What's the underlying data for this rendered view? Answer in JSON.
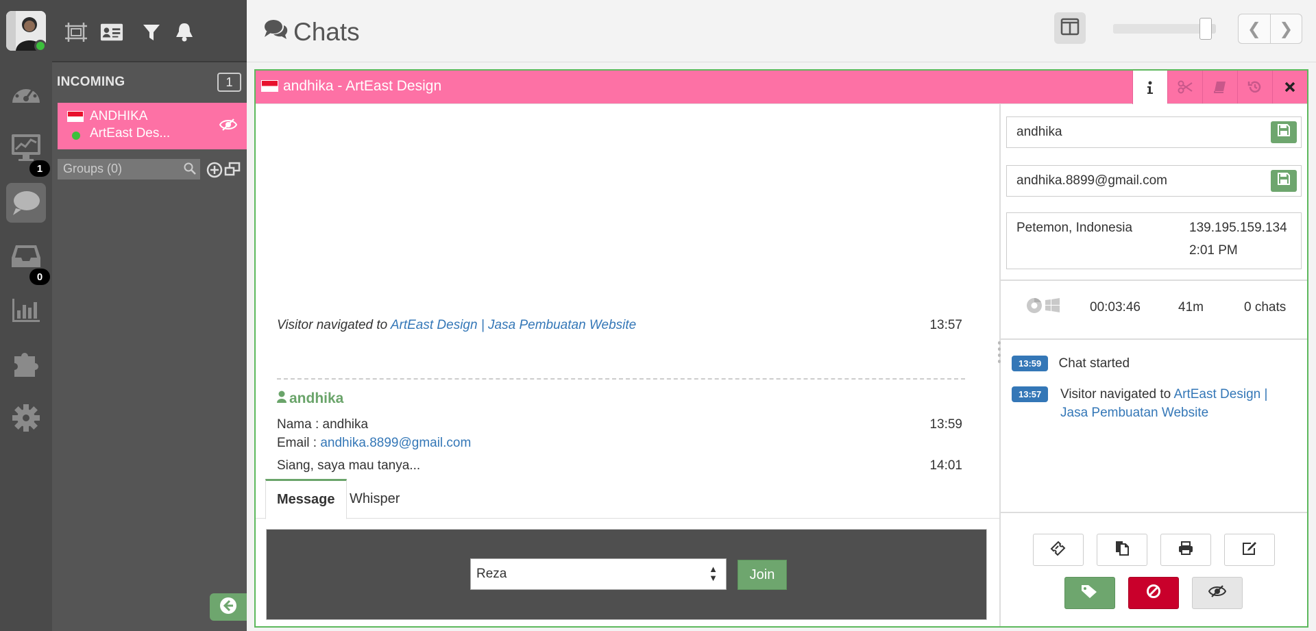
{
  "rail": {
    "badges": {
      "monitor": "1",
      "inbox": "0"
    }
  },
  "sidebar": {
    "incoming_title": "INCOMING",
    "incoming_count": "1",
    "chat": {
      "name": "ANDHIKA",
      "site": "ArtEast Des..."
    },
    "groups_placeholder": "Groups (0)"
  },
  "header": {
    "title": "Chats",
    "zoom_level": 0.9
  },
  "chat": {
    "title": "andhika - ArtEast Design",
    "messages": {
      "navigated_prefix": "Visitor navigated to",
      "navigated_link": "ArtEast Design | Jasa Pembuatan Website",
      "navigated_time": "13:57",
      "author": "andhika",
      "nama_line": "Nama : andhika",
      "nama_time": "13:59",
      "email_prefix": "Email :",
      "email_link": "andhika.8899@gmail.com",
      "last_msg": "Siang, saya mau tanya...",
      "last_time": "14:01"
    },
    "tabs": {
      "message": "Message",
      "whisper": "Whisper"
    },
    "composer": {
      "operator": "Reza",
      "join_label": "Join"
    }
  },
  "info": {
    "name_value": "andhika",
    "email_value": "andhika.8899@gmail.com",
    "location": "Petemon, Indonesia",
    "ip": "139.195.159.134",
    "local_time": "2:01 PM",
    "duration": "00:03:46",
    "visit": "41m",
    "chats": "0 chats",
    "timeline": [
      {
        "time": "13:59",
        "text": "Chat started"
      },
      {
        "time": "13:57",
        "prefix": "Visitor navigated to",
        "link_line1": "ArtEast Design |",
        "link_line2": "Jasa Pembuatan Website"
      }
    ]
  },
  "colors": {
    "accent_pink": "#fd71a5",
    "success_green": "#6ea66e",
    "danger_red": "#c9002b",
    "link_blue": "#3477b7"
  }
}
